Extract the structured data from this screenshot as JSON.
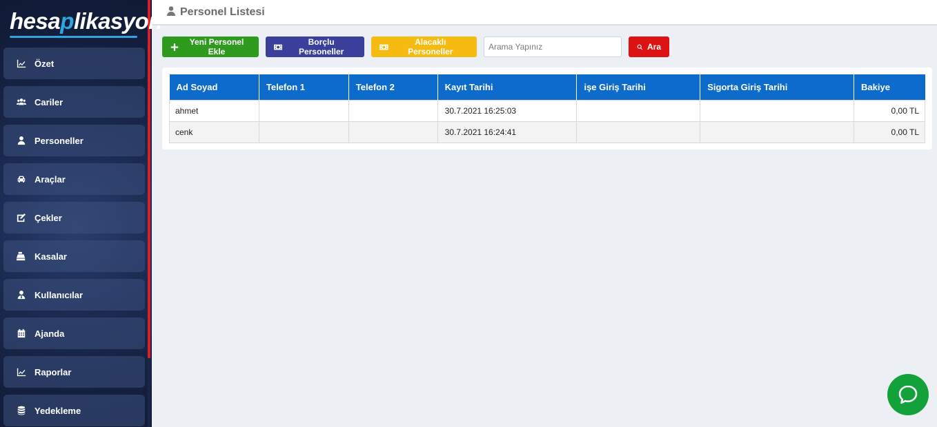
{
  "brand": {
    "logo_text_a": "hesa",
    "logo_text_p": "p",
    "logo_text_b": "likasyon"
  },
  "sidebar": {
    "items": [
      {
        "label": "Özet",
        "icon": "chart-line-icon"
      },
      {
        "label": "Cariler",
        "icon": "users-icon"
      },
      {
        "label": "Personeller",
        "icon": "user-icon"
      },
      {
        "label": "Araçlar",
        "icon": "car-icon"
      },
      {
        "label": "Çekler",
        "icon": "money-check-icon"
      },
      {
        "label": "Kasalar",
        "icon": "cash-register-icon"
      },
      {
        "label": "Kullanıcılar",
        "icon": "user-tie-icon"
      },
      {
        "label": "Ajanda",
        "icon": "calendar-icon"
      },
      {
        "label": "Raporlar",
        "icon": "chart-area-icon"
      },
      {
        "label": "Yedekleme",
        "icon": "database-icon"
      }
    ],
    "accent_color": "#d8202a"
  },
  "header": {
    "title": "Personel Listesi",
    "icon": "user-icon"
  },
  "toolbar": {
    "add_label": "Yeni Personel Ekle",
    "debtor_label": "Borçlu Personeller",
    "creditor_label": "Alacaklı Personeller",
    "search_placeholder": "Arama Yapınız",
    "search_button_label": "Ara",
    "colors": {
      "add": "#2e9a1e",
      "debtor": "#3b3f9b",
      "creditor": "#f6bb10",
      "search": "#dd1212"
    }
  },
  "table": {
    "columns": [
      "Ad Soyad",
      "Telefon 1",
      "Telefon 2",
      "Kayıt Tarihi",
      "işe Giriş Tarihi",
      "Sigorta Giriş Tarihi",
      "Bakiye"
    ],
    "rows": [
      [
        "ahmet",
        "",
        "",
        "30.7.2021 16:25:03",
        "",
        "",
        "0,00 TL"
      ],
      [
        "cenk",
        "",
        "",
        "30.7.2021 16:24:41",
        "",
        "",
        "0,00 TL"
      ]
    ],
    "header_color": "#0c6bcb"
  },
  "chat": {
    "icon": "chat-bubble-icon",
    "color": "#13a13a"
  }
}
